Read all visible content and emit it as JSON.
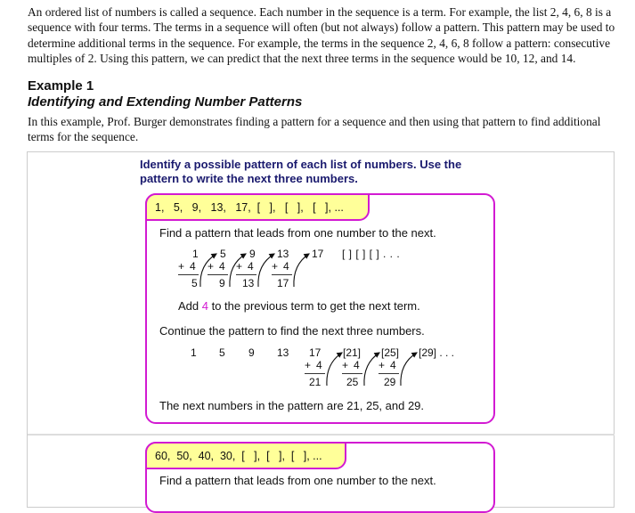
{
  "intro": {
    "text": "An ordered list of numbers is called a sequence. Each number in the sequence is a term. For example, the list 2, 4, 6, 8 is a sequence with four terms. The terms in a sequence will often (but not always) follow a pattern. This pattern may be used to determine additional terms in the sequence. For example, the terms in the sequence 2, 4, 6, 8 follow a pattern: consecutive multiples of 2. Using this pattern, we can predict that the next three terms in the sequence would be 10, 12, and 14."
  },
  "example": {
    "title": "Example 1",
    "subtitle": "Identifying and Extending Number Patterns",
    "description": "In this example, Prof. Burger demonstrates finding a pattern for a sequence and then using that pattern to find additional terms for the sequence."
  },
  "instructions": "Identify a possible pattern of each list of numbers. Use the pattern to write the next three numbers.",
  "colors": {
    "accent_magenta": "#d21ad2",
    "tab_yellow": "#ffff99",
    "instruction_navy": "#1a1a6e",
    "frame_gray": "#cccccc"
  },
  "problem1": {
    "sequence": "1,   5,   9,   13,   17,  [   ],   [   ],   [   ], ...",
    "step1": "Find a pattern that leads from one number to the next.",
    "diagram1": {
      "top_terms": [
        "1",
        "5",
        "9",
        "13",
        "17"
      ],
      "blanks": "[   ]    [   ]    [   ] . . .",
      "plus_sign": "+",
      "increment": "4",
      "sums": [
        "5",
        "9",
        "13",
        "17"
      ]
    },
    "rule_before": "Add ",
    "rule_value": "4",
    "rule_after": " to the previous term to get the next term.",
    "step2": "Continue the pattern to find the next three numbers.",
    "diagram2": {
      "given_terms": [
        "1",
        "5",
        "9",
        "13",
        "17"
      ],
      "new_terms": [
        "[21]",
        "[25]",
        "[29] . . ."
      ],
      "plus_sign": "+",
      "increment": "4",
      "sums": [
        "21",
        "25",
        "29"
      ]
    },
    "conclusion": "The next numbers in the pattern are 21, 25, and 29."
  },
  "problem2": {
    "sequence": "60,  50,  40,  30,  [   ],  [   ],  [   ], ...",
    "step1": "Find a pattern that leads from one number to the next."
  }
}
